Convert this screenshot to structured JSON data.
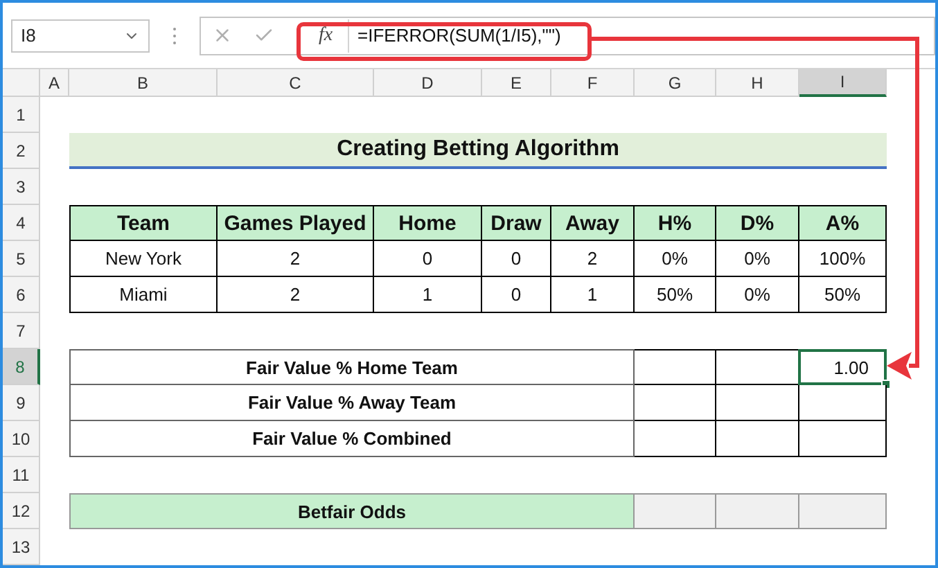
{
  "name_box": "I8",
  "fx_symbol": "fx",
  "formula": "=IFERROR(SUM(1/I5),\"\")",
  "columns": [
    {
      "label": "A",
      "selected": false
    },
    {
      "label": "B",
      "selected": false
    },
    {
      "label": "C",
      "selected": false
    },
    {
      "label": "D",
      "selected": false
    },
    {
      "label": "E",
      "selected": false
    },
    {
      "label": "F",
      "selected": false
    },
    {
      "label": "G",
      "selected": false
    },
    {
      "label": "H",
      "selected": false
    },
    {
      "label": "I",
      "selected": true
    }
  ],
  "rows": [
    {
      "label": "1",
      "selected": false
    },
    {
      "label": "2",
      "selected": false
    },
    {
      "label": "3",
      "selected": false
    },
    {
      "label": "4",
      "selected": false
    },
    {
      "label": "5",
      "selected": false
    },
    {
      "label": "6",
      "selected": false
    },
    {
      "label": "7",
      "selected": false
    },
    {
      "label": "8",
      "selected": true
    },
    {
      "label": "9",
      "selected": false
    },
    {
      "label": "10",
      "selected": false
    },
    {
      "label": "11",
      "selected": false
    },
    {
      "label": "12",
      "selected": false
    },
    {
      "label": "13",
      "selected": false
    }
  ],
  "title": "Creating Betting Algorithm",
  "stats_table": {
    "headers": [
      "Team",
      "Games Played",
      "Home",
      "Draw",
      "Away",
      "H%",
      "D%",
      "A%"
    ],
    "rows": [
      [
        "New York",
        "2",
        "0",
        "0",
        "2",
        "0%",
        "0%",
        "100%"
      ],
      [
        "Miami",
        "2",
        "1",
        "0",
        "1",
        "50%",
        "0%",
        "50%"
      ]
    ]
  },
  "fair_value_rows": [
    {
      "label": "Fair Value % Home Team",
      "value": "1.00",
      "selected": true
    },
    {
      "label": "Fair Value % Away Team",
      "selected": false
    },
    {
      "label": "Fair Value % Combined",
      "selected": false
    }
  ],
  "odds_row": {
    "label": "Betfair Odds"
  }
}
